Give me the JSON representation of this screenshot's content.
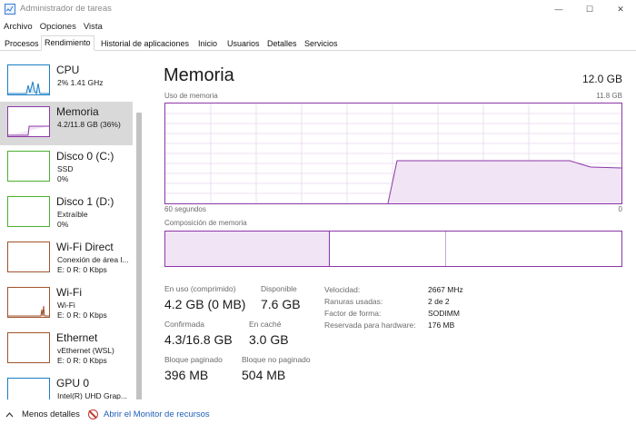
{
  "window": {
    "title": "Administrador de tareas",
    "controls": {
      "minimize": "—",
      "maximize": "☐",
      "close": "✕"
    }
  },
  "menu": [
    "Archivo",
    "Opciones",
    "Vista"
  ],
  "tabs": [
    {
      "label": "Procesos",
      "active": false
    },
    {
      "label": "Rendimiento",
      "active": true
    },
    {
      "label": "Historial de aplicaciones",
      "active": false
    },
    {
      "label": "Inicio",
      "active": false
    },
    {
      "label": "Usuarios",
      "active": false
    },
    {
      "label": "Detalles",
      "active": false
    },
    {
      "label": "Servicios",
      "active": false
    }
  ],
  "sidebar": [
    {
      "title": "CPU",
      "sub1": "2%  1.41 GHz",
      "sub2": "",
      "color": "#1a7dc4",
      "icon": "cpu-graph-icon"
    },
    {
      "title": "Memoria",
      "sub1": "4.2/11.8 GB (36%)",
      "sub2": "",
      "color": "#8b37a8",
      "icon": "memory-graph-icon",
      "selected": true
    },
    {
      "title": "Disco 0 (C:)",
      "sub1": "SSD",
      "sub2": "0%",
      "color": "#4caf2e",
      "icon": "disk-graph-icon"
    },
    {
      "title": "Disco 1 (D:)",
      "sub1": "Extraíble",
      "sub2": "0%",
      "color": "#4caf2e",
      "icon": "disk-graph-icon"
    },
    {
      "title": "Wi-Fi Direct",
      "sub1": "Conexión de área l...",
      "sub2": "E: 0 R: 0 Kbps",
      "color": "#a0522d",
      "icon": "network-graph-icon"
    },
    {
      "title": "Wi-Fi",
      "sub1": "Wi-Fi",
      "sub2": "E: 0 R: 0 Kbps",
      "color": "#a0522d",
      "icon": "network-graph-icon"
    },
    {
      "title": "Ethernet",
      "sub1": "vEthernet (WSL)",
      "sub2": "E: 0 R: 0 Kbps",
      "color": "#a0522d",
      "icon": "network-graph-icon"
    },
    {
      "title": "GPU 0",
      "sub1": "Intel(R) UHD Grap...",
      "sub2": "",
      "color": "#1a7dc4",
      "icon": "gpu-graph-icon"
    }
  ],
  "main": {
    "title": "Memoria",
    "total": "12.0 GB",
    "usage_label": "Uso de memoria",
    "usage_max": "11.8 GB",
    "time_left": "60 segundos",
    "time_right": "0",
    "composition_label": "Composición de memoria",
    "stats": {
      "in_use_label": "En uso (comprimido)",
      "in_use_value": "4.2 GB (0 MB)",
      "available_label": "Disponible",
      "available_value": "7.6 GB",
      "committed_label": "Confirmada",
      "committed_value": "4.3/16.8 GB",
      "cached_label": "En caché",
      "cached_value": "3.0 GB",
      "paged_label": "Bloque paginado",
      "paged_value": "396 MB",
      "nonpaged_label": "Bloque no paginado",
      "nonpaged_value": "504 MB"
    },
    "specs": [
      {
        "label": "Velocidad:",
        "value": "2667 MHz"
      },
      {
        "label": "Ranuras usadas:",
        "value": "2 de 2"
      },
      {
        "label": "Factor de forma:",
        "value": "SODIMM"
      },
      {
        "label": "Reservada para hardware:",
        "value": "176 MB"
      }
    ]
  },
  "footer": {
    "less_details": "Menos detalles",
    "resource_monitor": "Abrir el Monitor de recursos"
  },
  "accent": "#8b37a8"
}
